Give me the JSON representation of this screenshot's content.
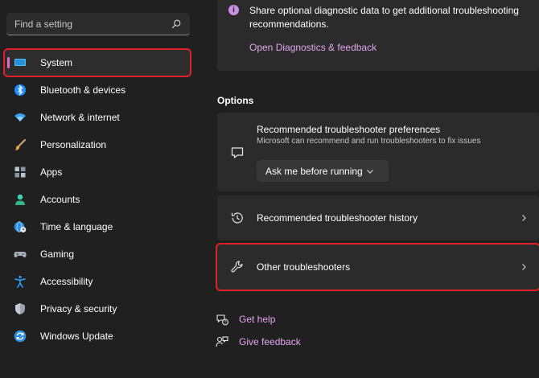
{
  "search": {
    "placeholder": "Find a setting"
  },
  "sidebar": {
    "items": [
      {
        "label": "System",
        "icon": "system-display-icon",
        "selected": true
      },
      {
        "label": "Bluetooth & devices",
        "icon": "bluetooth-icon"
      },
      {
        "label": "Network & internet",
        "icon": "wifi-icon"
      },
      {
        "label": "Personalization",
        "icon": "paintbrush-icon"
      },
      {
        "label": "Apps",
        "icon": "apps-icon"
      },
      {
        "label": "Accounts",
        "icon": "person-icon"
      },
      {
        "label": "Time & language",
        "icon": "globe-clock-icon"
      },
      {
        "label": "Gaming",
        "icon": "gamepad-icon"
      },
      {
        "label": "Accessibility",
        "icon": "accessibility-icon"
      },
      {
        "label": "Privacy & security",
        "icon": "shield-icon"
      },
      {
        "label": "Windows Update",
        "icon": "update-icon"
      }
    ]
  },
  "diagnostics": {
    "text": "Share optional diagnostic data to get additional troubleshooting recommendations.",
    "link": "Open Diagnostics & feedback"
  },
  "options": {
    "title": "Options",
    "preferences": {
      "title": "Recommended troubleshooter preferences",
      "subtitle": "Microsoft can recommend and run troubleshooters to fix issues",
      "dropdown_value": "Ask me before running"
    },
    "history_label": "Recommended troubleshooter history",
    "other_label": "Other troubleshooters"
  },
  "help": {
    "get_help": "Get help",
    "give_feedback": "Give feedback"
  },
  "colors": {
    "accent": "#e4a5f0",
    "highlight_border": "#e0202a",
    "background": "#202020",
    "card": "#2b2b2b"
  }
}
